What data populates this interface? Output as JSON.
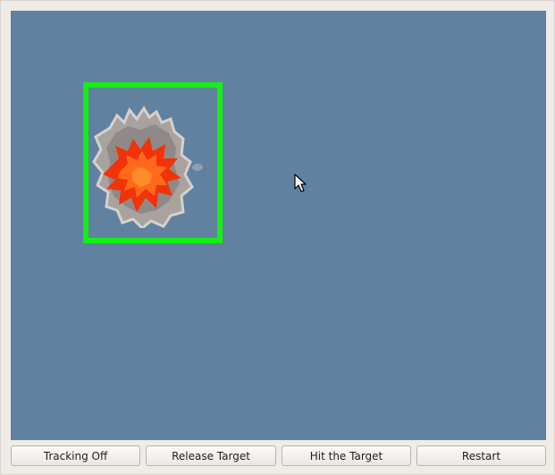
{
  "controls": {
    "tracking_label": "Tracking Off",
    "release_label": "Release Target",
    "hit_label": "Hit the Target",
    "restart_label": "Restart"
  },
  "colors": {
    "sky": "#6181a1",
    "target_box": "#13f011",
    "explosion_core": "#ff4a0a",
    "smoke": "#9e9a98",
    "window_bg": "#efebe7"
  },
  "icons": {
    "explosion": "explosion-sprite",
    "cursor": "arrow-cursor-icon"
  }
}
